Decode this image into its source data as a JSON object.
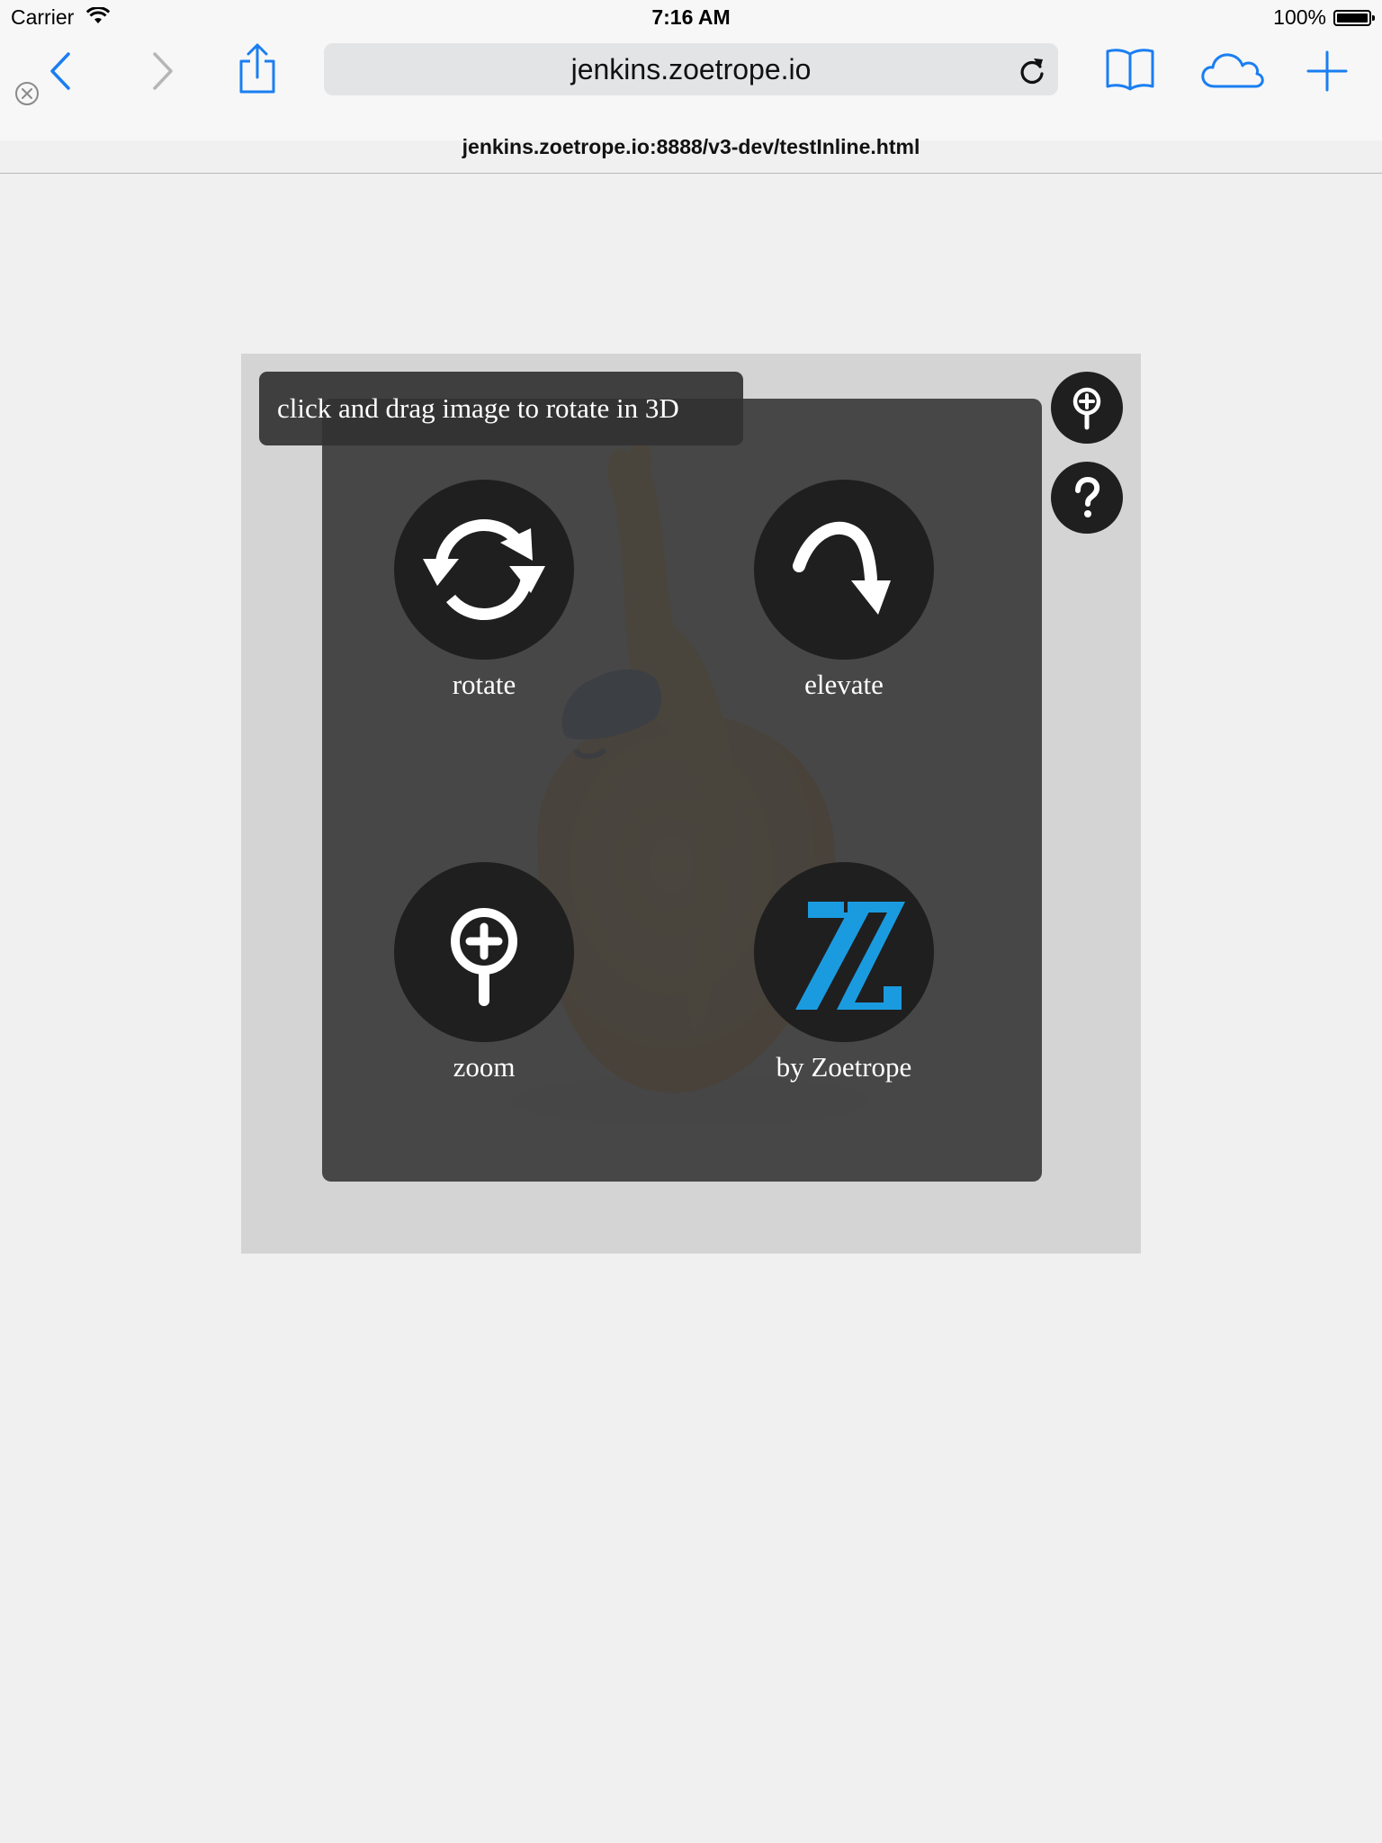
{
  "status_bar": {
    "carrier": "Carrier",
    "time": "7:16 AM",
    "battery": "100%"
  },
  "toolbar": {
    "address": "jenkins.zoetrope.io",
    "tab_title": "jenkins.zoetrope.io:8888/v3-dev/testInline.html",
    "accent_color": "#1a7ef2"
  },
  "viewer": {
    "hint": "click and drag image to rotate in 3D",
    "actions": [
      {
        "label": "rotate",
        "icon": "rotate-icon"
      },
      {
        "label": "elevate",
        "icon": "elevate-arrow-icon"
      },
      {
        "label": "zoom",
        "icon": "zoom-icon"
      },
      {
        "label": "by Zoetrope",
        "icon": "zoetrope-logo"
      }
    ],
    "logo_color": "#1a9be0"
  }
}
